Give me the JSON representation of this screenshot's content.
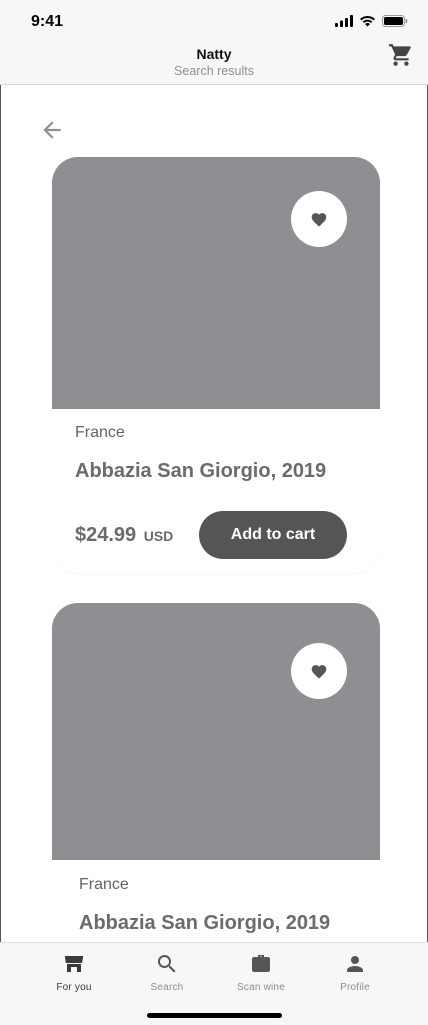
{
  "status": {
    "time": "9:41"
  },
  "header": {
    "title": "Natty",
    "subtitle": "Search results"
  },
  "cards": [
    {
      "origin": "France",
      "name": "Abbazia San Giorgio, 2019",
      "price": "$24.99",
      "currency": "USD",
      "cta": "Add to cart"
    },
    {
      "origin": "France",
      "name": "Abbazia San Giorgio, 2019"
    }
  ],
  "tabs": [
    {
      "label": "For you",
      "icon": "storefront-icon",
      "active": true
    },
    {
      "label": "Search",
      "icon": "search-icon",
      "active": false
    },
    {
      "label": "Scan wine",
      "icon": "briefcase-icon",
      "active": false
    },
    {
      "label": "Profile",
      "icon": "person-icon",
      "active": false
    }
  ],
  "colors": {
    "accent": "#555555",
    "image_placeholder": "#8e8e93",
    "bar_bg": "#f7f7f7"
  }
}
